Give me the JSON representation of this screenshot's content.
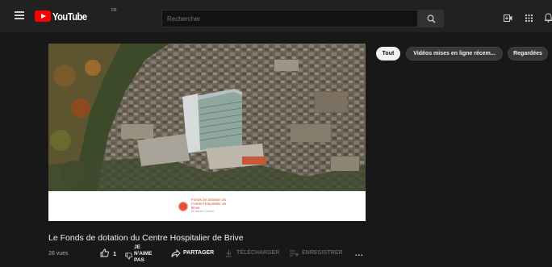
{
  "header": {
    "logo_text": "YouTube",
    "logo_country": "FR",
    "search_placeholder": "Rechercher"
  },
  "chips": [
    {
      "label": "Tout",
      "active": true
    },
    {
      "label": "Vidéos mises en ligne récem...",
      "active": false
    },
    {
      "label": "Regardées",
      "active": false
    }
  ],
  "video": {
    "card_line1": "Fonds de dotation du",
    "card_line2": "Centre Hospitalier de",
    "card_line3": "Brive",
    "card_line4": "Bri-santé Corrèze",
    "title": "Le Fonds de dotation du Centre Hospitalier de Brive",
    "views": "26 vues",
    "like_count": "1",
    "dislike_label": "JE N'AIME PAS",
    "share_label": "PARTAGER",
    "download_label": "TÉLÉCHARGER",
    "save_label": "ENREGISTRER",
    "more_label": "..."
  },
  "colors": {
    "background": "#181818",
    "topbar": "#212121",
    "brand_red": "#ff0000",
    "card_accent": "#e94e3a",
    "disabled_text": "#5e5e5e"
  }
}
